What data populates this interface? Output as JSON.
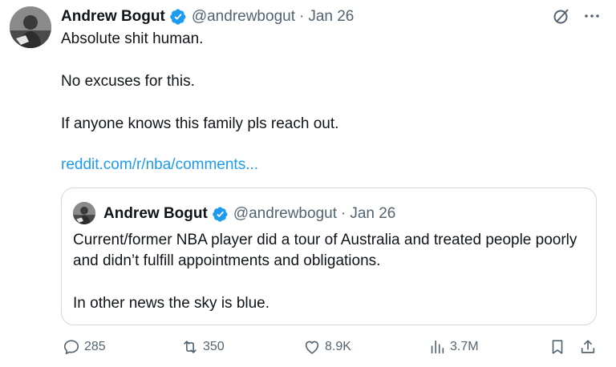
{
  "tweet": {
    "author_name": "Andrew Bogut",
    "handle": "@andrewbogut",
    "separator": "·",
    "date": "Jan 26",
    "paragraphs": [
      "Absolute shit human.",
      "No excuses for this.",
      "If anyone knows this family pls reach out."
    ],
    "link": "reddit.com/r/nba/comments...",
    "icons": {
      "top_right": [
        "grok-icon",
        "more-icon"
      ],
      "verified": "verified-badge-icon"
    }
  },
  "quoted_tweet": {
    "author_name": "Andrew Bogut",
    "handle": "@andrewbogut",
    "separator": "·",
    "date": "Jan 26",
    "paragraphs": [
      "Current/former NBA player did a tour of Australia and treated people poorly and didn’t fulfill appointments and obligations.",
      "In other news the sky is blue."
    ]
  },
  "actions": {
    "replies": "285",
    "retweets": "350",
    "likes": "8.9K",
    "views": "3.7M"
  },
  "colors": {
    "text": "#0f1419",
    "secondary": "#536471",
    "link": "#1d9bf0",
    "verified": "#1d9bf0",
    "border": "#cfd9de"
  }
}
